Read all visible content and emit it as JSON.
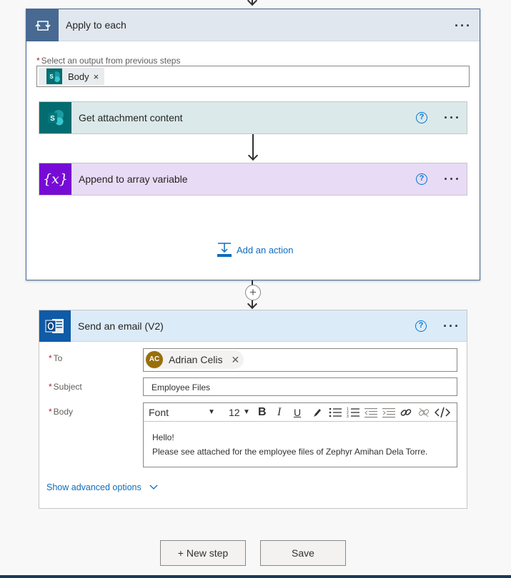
{
  "loop": {
    "title": "Apply to each",
    "select_label": "Select an output from previous steps",
    "token_label": "Body",
    "token_remove": "×",
    "more": "···"
  },
  "actions": [
    {
      "title": "Get attachment content",
      "help": "?",
      "more": "···",
      "color": "#dbe9ea",
      "icon_color": "#036c70"
    },
    {
      "title": "Append to array variable",
      "help": "?",
      "more": "···",
      "color": "#e8dbf5",
      "icon_color": "#770bd6"
    }
  ],
  "add_action": {
    "label": "Add an action"
  },
  "email": {
    "title": "Send an email (V2)",
    "help": "?",
    "more": "···",
    "to_label": "To",
    "to_person_initials": "AC",
    "to_person_name": "Adrian Celis",
    "to_remove": "✕",
    "subject_label": "Subject",
    "subject_value": "Employee Files",
    "body_label": "Body",
    "font_label": "Font",
    "font_size": "12",
    "body_line1": "Hello!",
    "body_line2": "Please see attached for the employee files of Zephyr Amihan Dela Torre.",
    "show_advanced": "Show advanced options"
  },
  "buttons": {
    "new_step": "+ New step",
    "save": "Save"
  },
  "colors": {
    "accent": "#0078d4",
    "loop_header": "#e1e7ef",
    "email_header": "#dcebf8"
  }
}
